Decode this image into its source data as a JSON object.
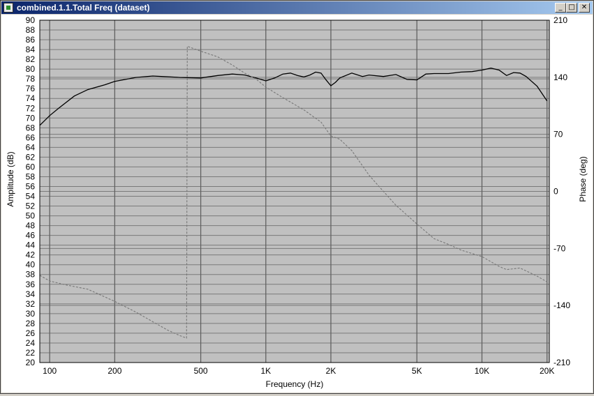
{
  "window": {
    "title": "combined.1.1.Total Freq (dataset)",
    "buttons": {
      "minimize": "_",
      "maximize": "□",
      "close": "✕"
    }
  },
  "colors": {
    "plot_bg": "#c0c0c0",
    "major_grid": "#606060",
    "minor_grid": "#7a7a7a",
    "amplitude_line": "#000000",
    "phase_line": "#777777"
  },
  "chart_data": {
    "type": "line",
    "xlabel": "Frequency (Hz)",
    "ylabel": "Amplitude (dB)",
    "y2label": "Phase (deg)",
    "xscale": "log",
    "xlim": [
      90,
      20500
    ],
    "ylim": [
      20,
      90
    ],
    "y2lim": [
      -210,
      210
    ],
    "grid": true,
    "x_ticks": [
      {
        "value": 100,
        "label": "100"
      },
      {
        "value": 200,
        "label": "200"
      },
      {
        "value": 500,
        "label": "500"
      },
      {
        "value": 1000,
        "label": "1K"
      },
      {
        "value": 2000,
        "label": "2K"
      },
      {
        "value": 5000,
        "label": "5K"
      },
      {
        "value": 10000,
        "label": "10K"
      },
      {
        "value": 20000,
        "label": "20K"
      }
    ],
    "y_ticks": [
      20,
      22,
      24,
      26,
      28,
      30,
      32,
      34,
      36,
      38,
      40,
      42,
      44,
      46,
      48,
      50,
      52,
      54,
      56,
      58,
      60,
      62,
      64,
      66,
      68,
      70,
      72,
      74,
      76,
      78,
      80,
      82,
      84,
      86,
      88,
      90
    ],
    "y2_ticks": [
      210,
      140,
      70,
      0,
      -70,
      -140,
      -210
    ],
    "series": [
      {
        "name": "",
        "axis": "left",
        "style": "solid",
        "x": [
          90,
          100,
          110,
          130,
          150,
          180,
          200,
          250,
          300,
          400,
          500,
          600,
          700,
          800,
          900,
          1000,
          1100,
          1200,
          1300,
          1400,
          1500,
          1600,
          1700,
          1800,
          1900,
          2000,
          2100,
          2200,
          2500,
          2800,
          3000,
          3500,
          4000,
          4500,
          5000,
          5500,
          6000,
          7000,
          8000,
          9000,
          10000,
          11000,
          12000,
          13000,
          14000,
          15000,
          16000,
          18000,
          20000
        ],
        "values": [
          68.5,
          70.5,
          72,
          74.5,
          75.8,
          76.8,
          77.5,
          78.3,
          78.6,
          78.3,
          78.2,
          78.7,
          79,
          78.8,
          78.2,
          77.6,
          78.2,
          79,
          79.2,
          78.7,
          78.4,
          78.8,
          79.4,
          79.2,
          77.8,
          76.6,
          77.3,
          78.2,
          79.2,
          78.5,
          78.8,
          78.5,
          78.9,
          77.9,
          77.8,
          79,
          79.1,
          79.1,
          79.4,
          79.5,
          79.8,
          80.2,
          79.8,
          78.7,
          79.3,
          79.2,
          78.5,
          76.5,
          73.5
        ]
      },
      {
        "name": "",
        "axis": "right",
        "style": "dashed",
        "x": [
          90,
          100,
          120,
          150,
          200,
          250,
          300,
          350,
          400,
          430,
          433,
          500,
          600,
          700,
          800,
          900,
          1000,
          1200,
          1500,
          1800,
          2000,
          2200,
          2500,
          3000,
          3500,
          4000,
          5000,
          6000,
          7000,
          8000,
          10000,
          12000,
          13000,
          15000,
          18000,
          20000
        ],
        "values": [
          -103,
          -110,
          -115,
          -120,
          -135,
          -148,
          -160,
          -170,
          -177,
          -180,
          178,
          172,
          165,
          155,
          145,
          138,
          128,
          115,
          100,
          85,
          68,
          64,
          50,
          20,
          0,
          -17,
          -40,
          -58,
          -65,
          -72,
          -80,
          -92,
          -96,
          -94,
          -104,
          -111
        ]
      }
    ]
  }
}
